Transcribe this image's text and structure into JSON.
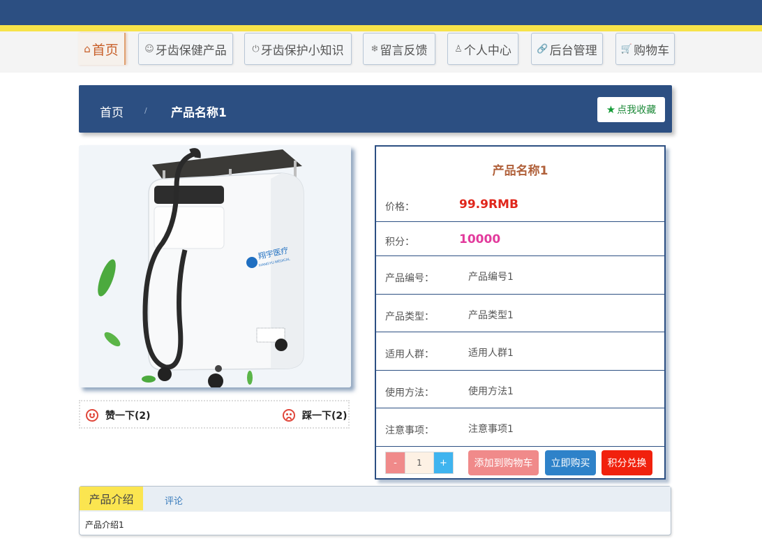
{
  "nav": {
    "items": [
      {
        "icon": "⌂",
        "label": "首页"
      },
      {
        "icon": "☺",
        "label": "牙齿保健产品"
      },
      {
        "icon": "⏻",
        "label": "牙齿保护小知识"
      },
      {
        "icon": "❄",
        "label": "留言反馈"
      },
      {
        "icon": "♙",
        "label": "个人中心"
      },
      {
        "icon": "🔗",
        "label": "后台管理"
      },
      {
        "icon": "🛒",
        "label": "购物车"
      }
    ]
  },
  "breadcrumb": {
    "home": "首页",
    "separator": "/",
    "current": "产品名称1",
    "favorite_label": "点我收藏"
  },
  "product_image": {
    "brand_text": "翔宇医疗",
    "brand_sub": "XIANGYU MEDICAL"
  },
  "votes": {
    "like_label": "赞一下(2)",
    "dislike_label": "踩一下(2)"
  },
  "info": {
    "title": "产品名称1",
    "rows": [
      {
        "label": "价格：",
        "value": "99.9RMB"
      },
      {
        "label": "积分：",
        "value": "10000"
      },
      {
        "label": "产品编号：",
        "value": "产品编号1"
      },
      {
        "label": "产品类型：",
        "value": "产品类型1"
      },
      {
        "label": "适用人群：",
        "value": "适用人群1"
      },
      {
        "label": "使用方法：",
        "value": "使用方法1"
      },
      {
        "label": "注意事项：",
        "value": "注意事项1"
      }
    ]
  },
  "actions": {
    "minus": "-",
    "quantity": "1",
    "plus": "+",
    "add_to_cart": "添加到购物车",
    "buy_now": "立即购买",
    "redeem": "积分兑换"
  },
  "tabs": {
    "intro_label": "产品介绍",
    "comments_label": "评论",
    "content": "产品介绍1"
  },
  "colors": {
    "primary": "#2c4f82",
    "accent_yellow": "#f7e34a",
    "price_red": "#e0261b",
    "points_pink": "#e23a9c"
  }
}
